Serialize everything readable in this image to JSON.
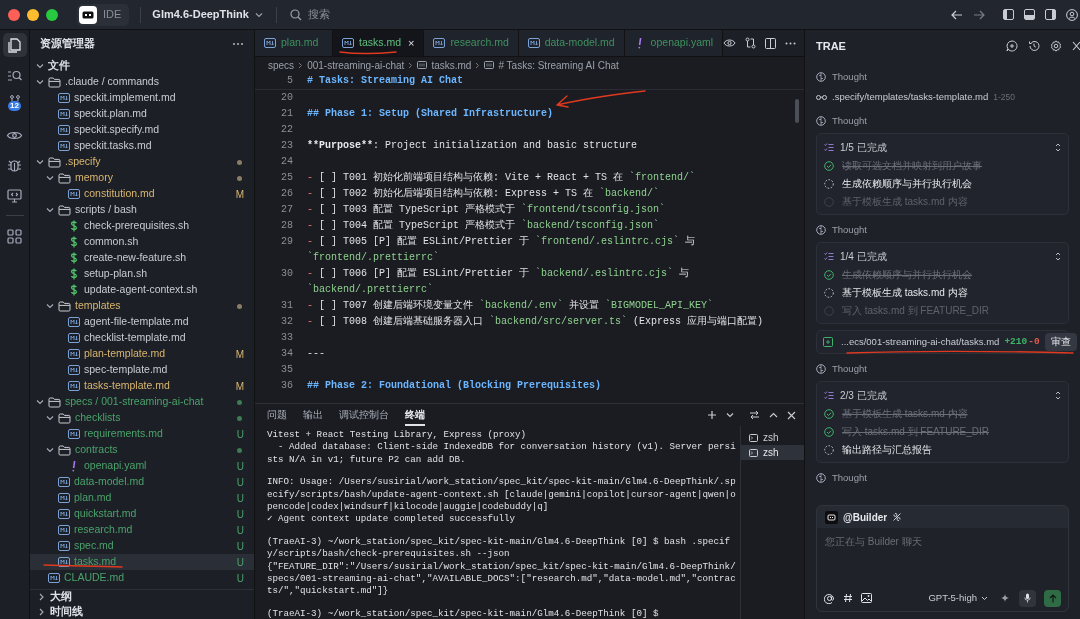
{
  "titlebar": {
    "app_label": "IDE",
    "project": "Glm4.6-DeepThink",
    "search_placeholder": "搜索"
  },
  "activity_bar": {
    "items": [
      {
        "selected": true
      },
      {
        "selected": false
      },
      {
        "selected": false,
        "badge": "12"
      },
      {
        "selected": false
      },
      {
        "selected": false
      },
      {
        "selected": false
      },
      {
        "selected": false
      }
    ]
  },
  "explorer": {
    "title": "资源管理器",
    "section": "文件",
    "tree": [
      {
        "name": ".claude / commands",
        "kind": "folder",
        "expanded": true,
        "modified": false,
        "untracked": false,
        "selected": false,
        "children": [
          {
            "name": "speckit.implement.md",
            "kind": "markdown",
            "modified": false,
            "untracked": false,
            "selected": false
          },
          {
            "name": "speckit.plan.md",
            "kind": "markdown",
            "modified": false,
            "untracked": false,
            "selected": false
          },
          {
            "name": "speckit.specify.md",
            "kind": "markdown",
            "modified": false,
            "untracked": false,
            "selected": false
          },
          {
            "name": "speckit.tasks.md",
            "kind": "markdown",
            "modified": false,
            "untracked": false,
            "selected": false
          }
        ]
      },
      {
        "name": ".specify",
        "kind": "folder",
        "expanded": true,
        "modified": true,
        "untracked": false,
        "dot": true,
        "selected": false,
        "children": [
          {
            "name": "memory",
            "kind": "folder",
            "expanded": true,
            "modified": true,
            "untracked": false,
            "dot": true,
            "selected": false,
            "children": [
              {
                "name": "constitution.md",
                "kind": "markdown",
                "modified": true,
                "untracked": false,
                "badge": "M",
                "selected": false
              }
            ]
          },
          {
            "name": "scripts / bash",
            "kind": "folder",
            "expanded": true,
            "modified": false,
            "untracked": false,
            "selected": false,
            "children": [
              {
                "name": "check-prerequisites.sh",
                "kind": "shell",
                "modified": false,
                "untracked": false,
                "selected": false
              },
              {
                "name": "common.sh",
                "kind": "shell",
                "modified": false,
                "untracked": false,
                "selected": false
              },
              {
                "name": "create-new-feature.sh",
                "kind": "shell",
                "modified": false,
                "untracked": false,
                "selected": false
              },
              {
                "name": "setup-plan.sh",
                "kind": "shell",
                "modified": false,
                "untracked": false,
                "selected": false
              },
              {
                "name": "update-agent-context.sh",
                "kind": "shell",
                "modified": false,
                "untracked": false,
                "selected": false
              }
            ]
          },
          {
            "name": "templates",
            "kind": "folder",
            "expanded": true,
            "modified": true,
            "untracked": false,
            "dot": true,
            "selected": false,
            "children": [
              {
                "name": "agent-file-template.md",
                "kind": "markdown",
                "modified": false,
                "untracked": false,
                "selected": false
              },
              {
                "name": "checklist-template.md",
                "kind": "markdown",
                "modified": false,
                "untracked": false,
                "selected": false
              },
              {
                "name": "plan-template.md",
                "kind": "markdown",
                "modified": true,
                "untracked": false,
                "badge": "M",
                "selected": false
              },
              {
                "name": "spec-template.md",
                "kind": "markdown",
                "modified": false,
                "untracked": false,
                "selected": false
              },
              {
                "name": "tasks-template.md",
                "kind": "markdown",
                "modified": true,
                "untracked": false,
                "badge": "M",
                "selected": false
              }
            ]
          }
        ]
      },
      {
        "name": "specs / 001-streaming-ai-chat",
        "kind": "folder",
        "expanded": true,
        "modified": false,
        "untracked": true,
        "dot": true,
        "selected": false,
        "children": [
          {
            "name": "checklists",
            "kind": "folder",
            "expanded": true,
            "modified": false,
            "untracked": true,
            "dot": true,
            "selected": false,
            "children": [
              {
                "name": "requirements.md",
                "kind": "markdown",
                "modified": false,
                "untracked": true,
                "badge": "U",
                "selected": false
              }
            ]
          },
          {
            "name": "contracts",
            "kind": "folder",
            "expanded": true,
            "modified": false,
            "untracked": true,
            "dot": true,
            "selected": false,
            "children": [
              {
                "name": "openapi.yaml",
                "kind": "yaml",
                "modified": false,
                "untracked": true,
                "badge": "U",
                "selected": false
              }
            ]
          },
          {
            "name": "data-model.md",
            "kind": "markdown",
            "modified": false,
            "untracked": true,
            "badge": "U",
            "selected": false
          },
          {
            "name": "plan.md",
            "kind": "markdown",
            "modified": false,
            "untracked": true,
            "badge": "U",
            "selected": false
          },
          {
            "name": "quickstart.md",
            "kind": "markdown",
            "modified": false,
            "untracked": true,
            "badge": "U",
            "selected": false
          },
          {
            "name": "research.md",
            "kind": "markdown",
            "modified": false,
            "untracked": true,
            "badge": "U",
            "selected": false
          },
          {
            "name": "spec.md",
            "kind": "markdown",
            "modified": false,
            "untracked": true,
            "badge": "U",
            "selected": false
          },
          {
            "name": "tasks.md",
            "kind": "markdown",
            "modified": false,
            "untracked": true,
            "badge": "U",
            "selected": true
          }
        ]
      },
      {
        "name": "CLAUDE.md",
        "kind": "markdown",
        "modified": false,
        "untracked": true,
        "badge": "U",
        "selected": false
      }
    ],
    "panels": [
      {
        "label": "大纲",
        "expanded": false
      },
      {
        "label": "时间线",
        "expanded": false
      }
    ]
  },
  "editor": {
    "tabs": [
      {
        "label": "plan.md",
        "kind": "markdown",
        "selected": false
      },
      {
        "label": "tasks.md",
        "kind": "markdown",
        "selected": true,
        "close": "×"
      },
      {
        "label": "research.md",
        "kind": "markdown",
        "selected": false
      },
      {
        "label": "data-model.md",
        "kind": "markdown",
        "selected": false
      },
      {
        "label": "openapi.yaml",
        "kind": "yaml",
        "selected": false
      }
    ],
    "breadcrumb": [
      "specs",
      "001-streaming-ai-chat",
      "tasks.md",
      "# Tasks: Streaming AI Chat"
    ],
    "sticky_line": {
      "number": "5",
      "segments": [
        {
          "kind": "heading",
          "text": "# Tasks: Streaming AI Chat"
        }
      ]
    },
    "lines": [
      {
        "number": "20"
      },
      {
        "number": "21",
        "segments": [
          {
            "kind": "heading",
            "text": "## Phase 1: Setup (Shared Infrastructure)"
          }
        ]
      },
      {
        "number": "22"
      },
      {
        "number": "23",
        "segments": [
          {
            "kind": "bold",
            "text": "**Purpose**"
          },
          {
            "kind": "plain",
            "text": ": Project initialization and basic structure"
          }
        ]
      },
      {
        "number": "24"
      },
      {
        "number": "25",
        "segments": [
          {
            "kind": "marker",
            "text": "-"
          },
          {
            "kind": "plain",
            "text": " [ ] T001 初始化前端项目结构与依赖: Vite + React + TS 在 "
          },
          {
            "kind": "code",
            "text": "`frontend/`"
          }
        ]
      },
      {
        "number": "26",
        "segments": [
          {
            "kind": "marker",
            "text": "-"
          },
          {
            "kind": "plain",
            "text": " [ ] T002 初始化后端项目结构与依赖: Express + TS 在 "
          },
          {
            "kind": "code",
            "text": "`backend/`"
          }
        ]
      },
      {
        "number": "27",
        "segments": [
          {
            "kind": "marker",
            "text": "-"
          },
          {
            "kind": "plain",
            "text": " [ ] T003 配置 TypeScript 严格模式于 "
          },
          {
            "kind": "code",
            "text": "`frontend/tsconfig.json`"
          }
        ]
      },
      {
        "number": "28",
        "segments": [
          {
            "kind": "marker",
            "text": "-"
          },
          {
            "kind": "plain",
            "text": " [ ] T004 配置 TypeScript 严格模式于 "
          },
          {
            "kind": "code",
            "text": "`backend/tsconfig.json`"
          }
        ]
      },
      {
        "number": "29",
        "segments": [
          {
            "kind": "marker",
            "text": "-"
          },
          {
            "kind": "plain",
            "text": " [ ] T005 [P] 配置 ESLint/Prettier 于 "
          },
          {
            "kind": "code",
            "text": "`frontend/.eslintrc.cjs`"
          },
          {
            "kind": "plain",
            "text": " 与 "
          },
          {
            "kind": "code",
            "text": "`frontend/.prettierrc`"
          }
        ]
      },
      {
        "number": "30",
        "segments": [
          {
            "kind": "marker",
            "text": "-"
          },
          {
            "kind": "plain",
            "text": " [ ] T006 [P] 配置 ESLint/Prettier 于 "
          },
          {
            "kind": "code",
            "text": "`backend/.eslintrc.cjs`"
          },
          {
            "kind": "plain",
            "text": " 与 "
          },
          {
            "kind": "code",
            "text": "`backend/.prettierrc`"
          }
        ]
      },
      {
        "number": "31",
        "segments": [
          {
            "kind": "marker",
            "text": "-"
          },
          {
            "kind": "plain",
            "text": " [ ] T007 创建后端环境变量文件 "
          },
          {
            "kind": "code",
            "text": "`backend/.env`"
          },
          {
            "kind": "plain",
            "text": " 并设置 "
          },
          {
            "kind": "code",
            "text": "`BIGMODEL_API_KEY`"
          }
        ]
      },
      {
        "number": "32",
        "segments": [
          {
            "kind": "marker",
            "text": "-"
          },
          {
            "kind": "plain",
            "text": " [ ] T008 创建后端基础服务器入口 "
          },
          {
            "kind": "code",
            "text": "`backend/src/server.ts`"
          },
          {
            "kind": "plain",
            "text": " (Express 应用与端口配置)"
          }
        ]
      },
      {
        "number": "33"
      },
      {
        "number": "34",
        "segments": [
          {
            "kind": "plain",
            "text": "---"
          }
        ]
      },
      {
        "number": "35"
      },
      {
        "number": "36",
        "segments": [
          {
            "kind": "heading",
            "text": "## Phase 2: Foundational (Blocking Prerequisites)"
          }
        ]
      }
    ]
  },
  "panel": {
    "tabs": [
      {
        "label": "问题",
        "selected": false
      },
      {
        "label": "输出",
        "selected": false
      },
      {
        "label": "调试控制台",
        "selected": false
      },
      {
        "label": "终端",
        "selected": true
      }
    ],
    "terminal_blocks": [
      [
        "Vitest + React Testing Library, Express (proxy)",
        "  - Added database: Client-side IndexedDB for conversation history (v1). Server persists N/A in v1; future P2 can add DB."
      ],
      [
        "INFO: Usage: /Users/susirial/work_station/spec_kit/spec-kit-main/Glm4.6-DeepThink/.specify/scripts/bash/update-agent-context.sh [claude|gemini|copilot|cursor-agent|qwen|opencode|codex|windsurf|kilocode|auggie|codebuddy|q]",
        "✓ Agent context update completed successfully"
      ],
      [
        "(TraeAI-3) ~/work_station/spec_kit/spec-kit-main/Glm4.6-DeepThink [0] $ bash .specify/scripts/bash/check-prerequisites.sh --json",
        "{\"FEATURE_DIR\":\"/Users/susirial/work_station/spec_kit/spec-kit-main/Glm4.6-DeepThink/specs/001-streaming-ai-chat\",\"AVAILABLE_DOCS\":[\"research.md\",\"data-model.md\",\"contracts/\",\"quickstart.md\"]}"
      ],
      [
        "(TraeAI-3) ~/work_station/spec_kit/spec-kit-main/Glm4.6-DeepThink [0] $"
      ]
    ],
    "terminals": [
      {
        "label": "zsh",
        "selected": false
      },
      {
        "label": "zsh",
        "selected": true
      }
    ]
  },
  "assistant": {
    "title": "TRAE",
    "feed": [
      {
        "kind": "thought",
        "text": "Thought"
      },
      {
        "kind": "read",
        "path": ".specify/templates/tasks-template.md",
        "range": "1-250"
      },
      {
        "kind": "thought",
        "text": "Thought"
      },
      {
        "kind": "todo",
        "title": "1/5 已完成",
        "items": [
          {
            "text": "读取可选文档并映射到用户故事",
            "checked": true,
            "active": false
          },
          {
            "text": "生成依赖顺序与并行执行机会",
            "checked": false,
            "active": true
          },
          {
            "text": "基于模板生成 tasks.md 内容",
            "checked": false,
            "active": false
          }
        ]
      },
      {
        "kind": "thought",
        "text": "Thought"
      },
      {
        "kind": "todo",
        "title": "1/4 已完成",
        "items": [
          {
            "text": "生成依赖顺序与并行执行机会",
            "checked": true,
            "active": false
          },
          {
            "text": "基于模板生成 tasks.md 内容",
            "checked": false,
            "active": true
          },
          {
            "text": "写入 tasks.md 到 FEATURE_DIR",
            "checked": false,
            "active": false
          }
        ]
      },
      {
        "kind": "edit",
        "path": "...ecs/001-streaming-ai-chat/tasks.md",
        "added": "+210",
        "removed": "-0",
        "action": "审查"
      },
      {
        "kind": "thought",
        "text": "Thought"
      },
      {
        "kind": "todo",
        "title": "2/3 已完成",
        "items": [
          {
            "text": "基于模板生成 tasks.md 内容",
            "checked": true,
            "active": false
          },
          {
            "text": "写入 tasks.md 到 FEATURE_DIR",
            "checked": true,
            "active": false
          },
          {
            "text": "输出路径与汇总报告",
            "checked": false,
            "active": true
          }
        ]
      },
      {
        "kind": "thought",
        "text": "Thought"
      }
    ],
    "composer": {
      "agent": "@Builder",
      "placeholder": "您正在与 Builder 聊天",
      "model": "GPT-5-high"
    }
  }
}
